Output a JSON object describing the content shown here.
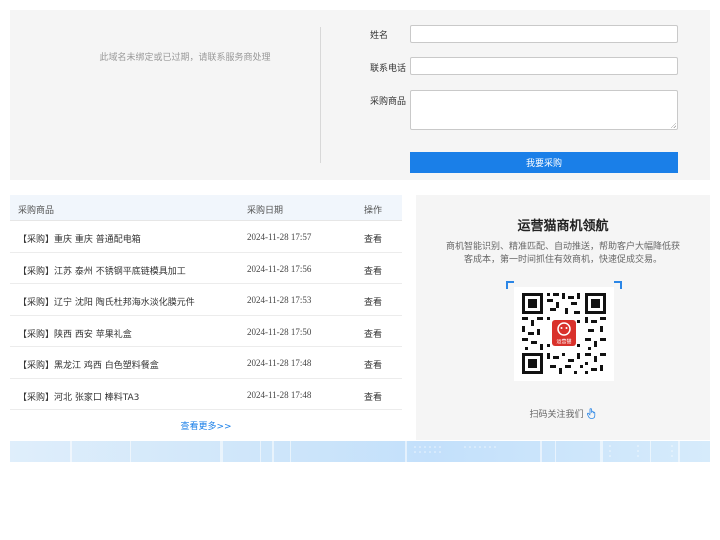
{
  "domain_notice": "此域名未绑定或已过期，请联系服务商处理",
  "form": {
    "name_label": "姓名",
    "phone_label": "联系电话",
    "goods_label": "采购商品",
    "name_value": "",
    "phone_value": "",
    "goods_value": "",
    "submit_label": "我要采购"
  },
  "table": {
    "headers": {
      "goods": "采购商品",
      "date": "采购日期",
      "action": "操作"
    },
    "rows": [
      {
        "goods": "【采购】重庆 重庆 普通配电箱",
        "date": "2024-11-28 17:57",
        "action": "查看"
      },
      {
        "goods": "【采购】江苏 泰州 不锈钢平底链模具加工",
        "date": "2024-11-28 17:56",
        "action": "查看"
      },
      {
        "goods": "【采购】辽宁 沈阳 陶氏杜邦海水淡化膜元件",
        "date": "2024-11-28 17:53",
        "action": "查看"
      },
      {
        "goods": "【采购】陕西 西安 苹果礼盒",
        "date": "2024-11-28 17:50",
        "action": "查看"
      },
      {
        "goods": "【采购】黑龙江 鸡西 白色塑料餐盒",
        "date": "2024-11-28 17:48",
        "action": "查看"
      },
      {
        "goods": "【采购】河北 张家口 棒料TA3",
        "date": "2024-11-28 17:48",
        "action": "查看"
      }
    ],
    "more_label": "查看更多>>"
  },
  "promo": {
    "title": "运营猫商机领航",
    "description": "商机智能识别、精准匹配、自动推送，帮助客户大幅降低获客成本，第一时间抓住有效商机，快速促成交易。",
    "qr_logo_text": "运营猫",
    "scan_tip": "扫码关注我们",
    "hand_icon": "pointing-hand-icon"
  },
  "colors": {
    "accent": "#1a7fe8",
    "panel_bg": "#f5f5f5",
    "table_header_bg": "#f1f6fc",
    "qr_logo_red": "#d9312b"
  }
}
